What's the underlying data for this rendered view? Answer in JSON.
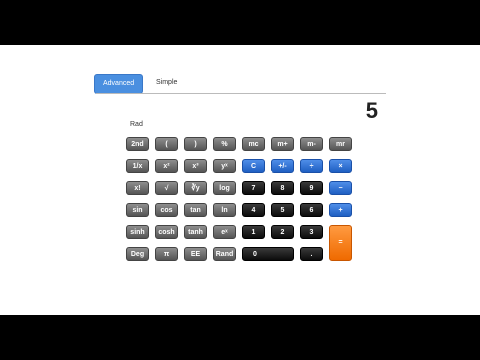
{
  "tabs": {
    "advanced": "Advanced",
    "simple": "Simple"
  },
  "display": {
    "value": "5",
    "mode": "Rad"
  },
  "rows": [
    [
      "2nd",
      "(",
      ")",
      "%",
      "mc",
      "m+",
      "m-",
      "mr"
    ],
    [
      "1/x",
      "x²",
      "x³",
      "yˣ",
      "C",
      "+/-",
      "÷",
      "×"
    ],
    [
      "x!",
      "√",
      "∛y",
      "log",
      "7",
      "8",
      "9",
      "−"
    ],
    [
      "sin",
      "cos",
      "tan",
      "ln",
      "4",
      "5",
      "6",
      "+"
    ],
    [
      "sinh",
      "cosh",
      "tanh",
      "eˣ",
      "1",
      "2",
      "3",
      "="
    ],
    [
      "Deg",
      "π",
      "EE",
      "Rand",
      "0",
      "",
      "."
    ]
  ],
  "colors": {
    "accent": "#4a8fe0",
    "equals": "#ef6a00"
  }
}
